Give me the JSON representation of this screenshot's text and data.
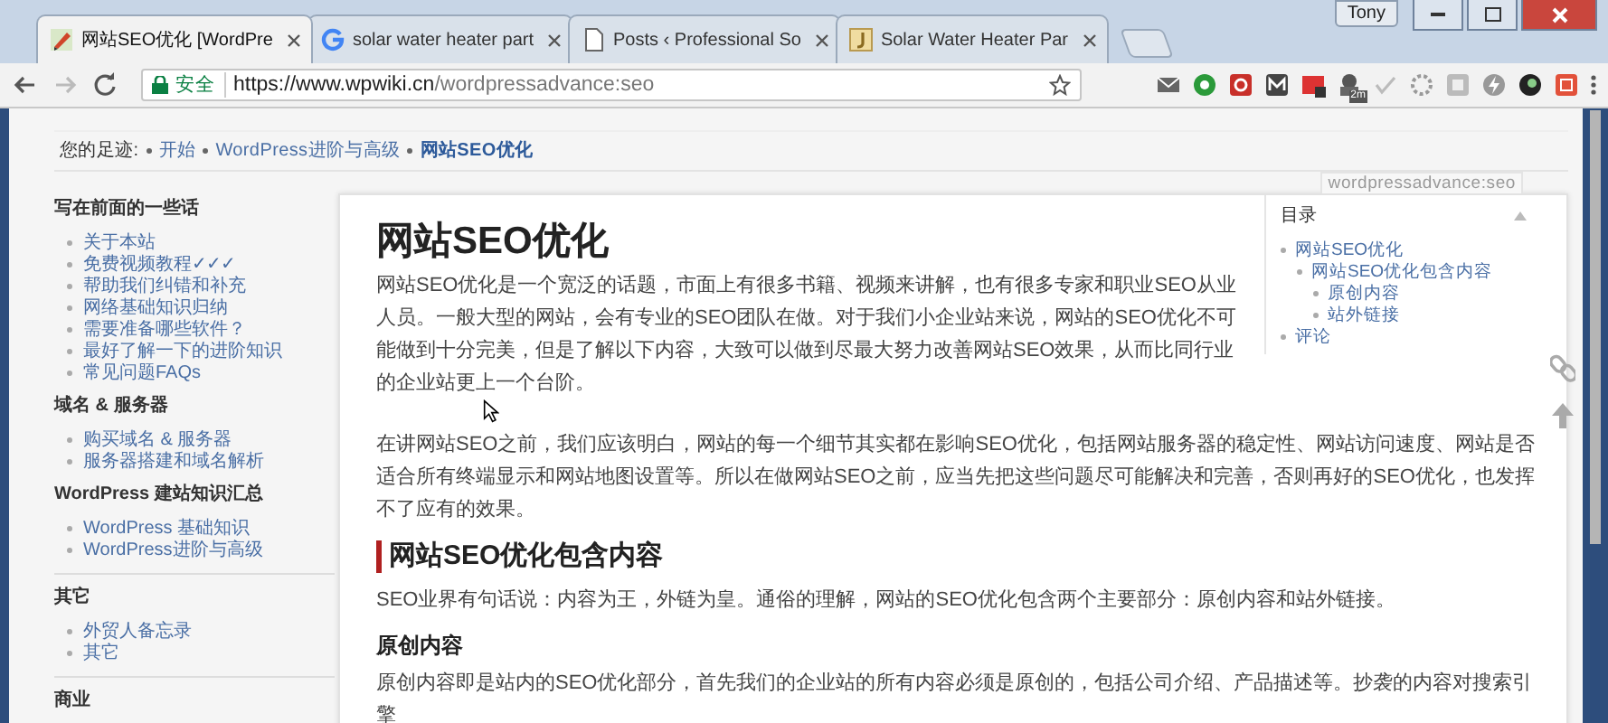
{
  "window": {
    "user": "Tony"
  },
  "tabs": [
    {
      "title": "网站SEO优化 [WordPre",
      "selected": true
    },
    {
      "title": "solar water heater part",
      "selected": false
    },
    {
      "title": "Posts ‹ Professional So",
      "selected": false
    },
    {
      "title": "Solar Water Heater Par",
      "selected": false
    }
  ],
  "address": {
    "secure_label": "安全",
    "host": "https://www.wpwiki.cn",
    "path": "/wordpressadvance:seo"
  },
  "toolbar": {
    "badge": "2m"
  },
  "breadcrumb": {
    "label": "您的足迹:",
    "items": [
      {
        "text": "开始",
        "current": false
      },
      {
        "text": "WordPress进阶与高级",
        "current": false
      },
      {
        "text": "网站SEO优化",
        "current": true
      }
    ]
  },
  "sidebar": [
    {
      "title": "写在前面的一些话",
      "separated": false,
      "items": [
        "关于本站",
        "免费视频教程✓✓✓",
        "帮助我们纠错和补充",
        "网络基础知识归纳",
        "需要准备哪些软件？",
        "最好了解一下的进阶知识",
        "常见问题FAQs"
      ]
    },
    {
      "title": "域名 & 服务器",
      "separated": false,
      "items": [
        "购买域名 & 服务器",
        "服务器搭建和域名解析"
      ]
    },
    {
      "title": "WordPress 建站知识汇总",
      "separated": false,
      "items": [
        "WordPress 基础知识",
        "WordPress进阶与高级"
      ]
    },
    {
      "title": "其它",
      "separated": true,
      "items": [
        "外贸人备忘录",
        "其它"
      ]
    },
    {
      "title": "商业",
      "separated": true
    }
  ],
  "article": {
    "tag": "wordpressadvance:seo",
    "title": "网站SEO优化",
    "paragraphs": [
      "网站SEO优化是一个宽泛的话题，市面上有很多书籍、视频来讲解，也有很多专家和职业SEO从业人员。一般大型的网站，会有专业的SEO团队在做。对于我们小企业站来说，网站的SEO优化不可能做到十分完美，但是了解以下内容，大致可以做到尽最大努力改善网站SEO效果，从而比同行业的企业站更上一个台阶。",
      "在讲网站SEO之前，我们应该明白，网站的每一个细节其实都在影响SEO优化，包括网站服务器的稳定性、网站访问速度、网站是否适合所有终端显示和网站地图设置等。所以在做网站SEO之前，应当先把这些问题尽可能解决和完善，否则再好的SEO优化，也发挥不了应有的效果。"
    ],
    "section": {
      "heading": "网站SEO优化包含内容",
      "paragraph": "SEO业界有句话说：内容为王，外链为皇。通俗的理解，网站的SEO优化包含两个主要部分：原创内容和站外链接。",
      "subheading": "原创内容",
      "subparagraph": "原创内容即是站内的SEO优化部分，首先我们的企业站的所有内容必须是原创的，包括公司介绍、产品描述等。抄袭的内容对搜索引擎"
    }
  },
  "toc": {
    "title": "目录",
    "items": [
      {
        "text": "网站SEO优化",
        "children": [
          {
            "text": "网站SEO优化包含内容",
            "children": [
              {
                "text": "原创内容"
              },
              {
                "text": "站外链接"
              }
            ]
          }
        ]
      },
      {
        "text": "评论"
      }
    ]
  }
}
